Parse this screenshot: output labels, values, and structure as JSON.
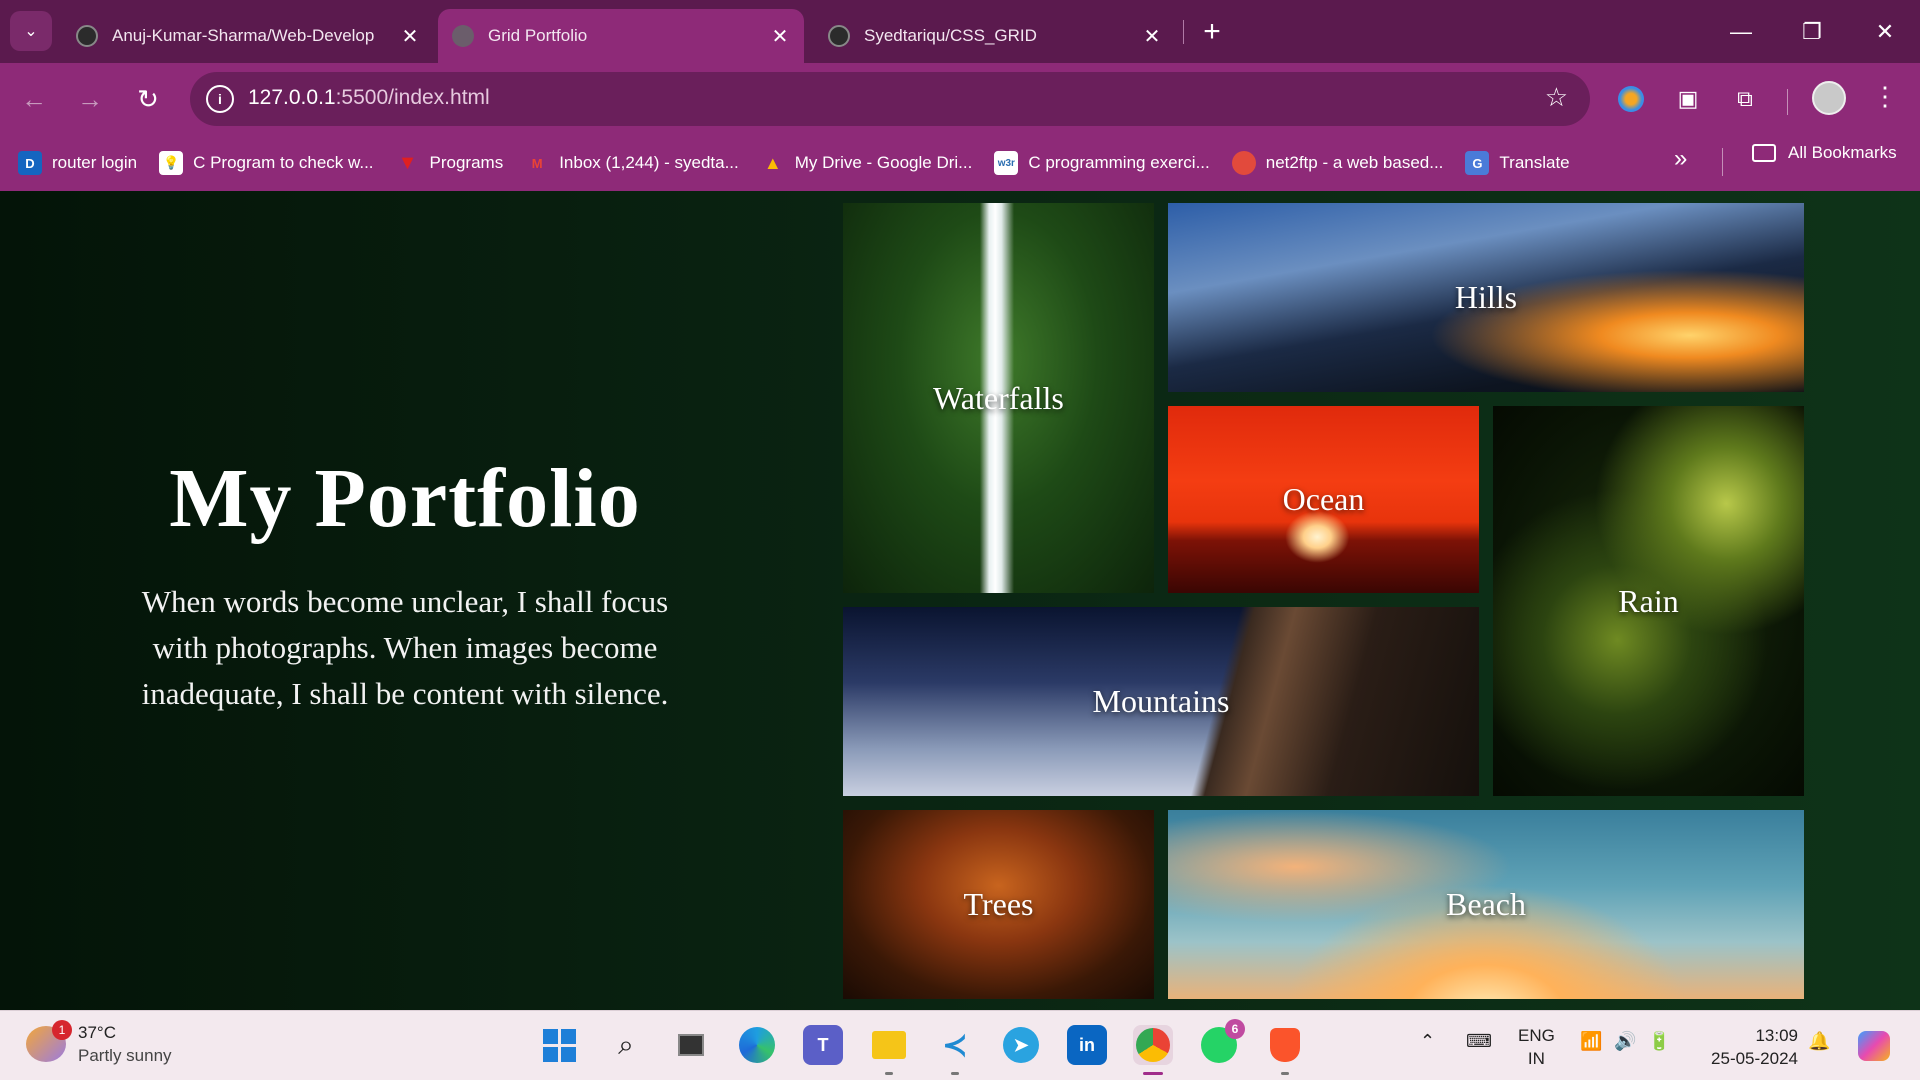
{
  "browser": {
    "tabs": [
      {
        "title": "Anuj-Kumar-Sharma/Web-Develop",
        "icon": "github-icon",
        "active": false
      },
      {
        "title": "Grid Portfolio",
        "icon": "globe-icon",
        "active": true
      },
      {
        "title": "Syedtariqu/CSS_GRID",
        "icon": "github-icon",
        "active": false
      }
    ],
    "url_host": "127.0.0.1",
    "url_rest": ":5500/index.html",
    "bookmarks": [
      {
        "label": "router login",
        "icon": "d-logo-icon",
        "color": "#1565c0",
        "glyph": "D"
      },
      {
        "label": "C Program to check w...",
        "icon": "bulb-icon",
        "color": "#ffffff",
        "glyph": "💡"
      },
      {
        "label": "Programs",
        "icon": "triangle-icon",
        "color": "#d81b1b",
        "glyph": "▼"
      },
      {
        "label": "Inbox (1,244) - syedta...",
        "icon": "gmail-icon",
        "color": "#ffffff",
        "glyph": "M"
      },
      {
        "label": "My Drive - Google Dri...",
        "icon": "drive-icon",
        "color": "#ffffff",
        "glyph": "▲"
      },
      {
        "label": "C programming exerci...",
        "icon": "w3r-icon",
        "color": "#ffffff",
        "glyph": "w3r"
      },
      {
        "label": "net2ftp - a web based...",
        "icon": "net2ftp-icon",
        "color": "#e24a3c",
        "glyph": "●"
      },
      {
        "label": "Translate",
        "icon": "translate-icon",
        "color": "#4a7bd8",
        "glyph": "G"
      }
    ],
    "all_bookmarks": "All Bookmarks"
  },
  "page": {
    "title": "My Portfolio",
    "quote": "When words become unclear, I shall focus with photographs. When images become inadequate, I shall be content with silence.",
    "tiles": [
      "Waterfalls",
      "Hills",
      "Ocean",
      "Rain",
      "Mountains",
      "Trees",
      "Beach"
    ]
  },
  "taskbar": {
    "weather_temp": "37°C",
    "weather_desc": "Partly sunny",
    "weather_badge": "1",
    "whatsapp_badge": "6",
    "lang_top": "ENG",
    "lang_bottom": "IN",
    "time": "13:09",
    "date": "25-05-2024"
  },
  "colors": {
    "tab_bar": "#5b1a4e",
    "toolbar": "#8e2a78",
    "page_bg": "#0b1f12"
  }
}
